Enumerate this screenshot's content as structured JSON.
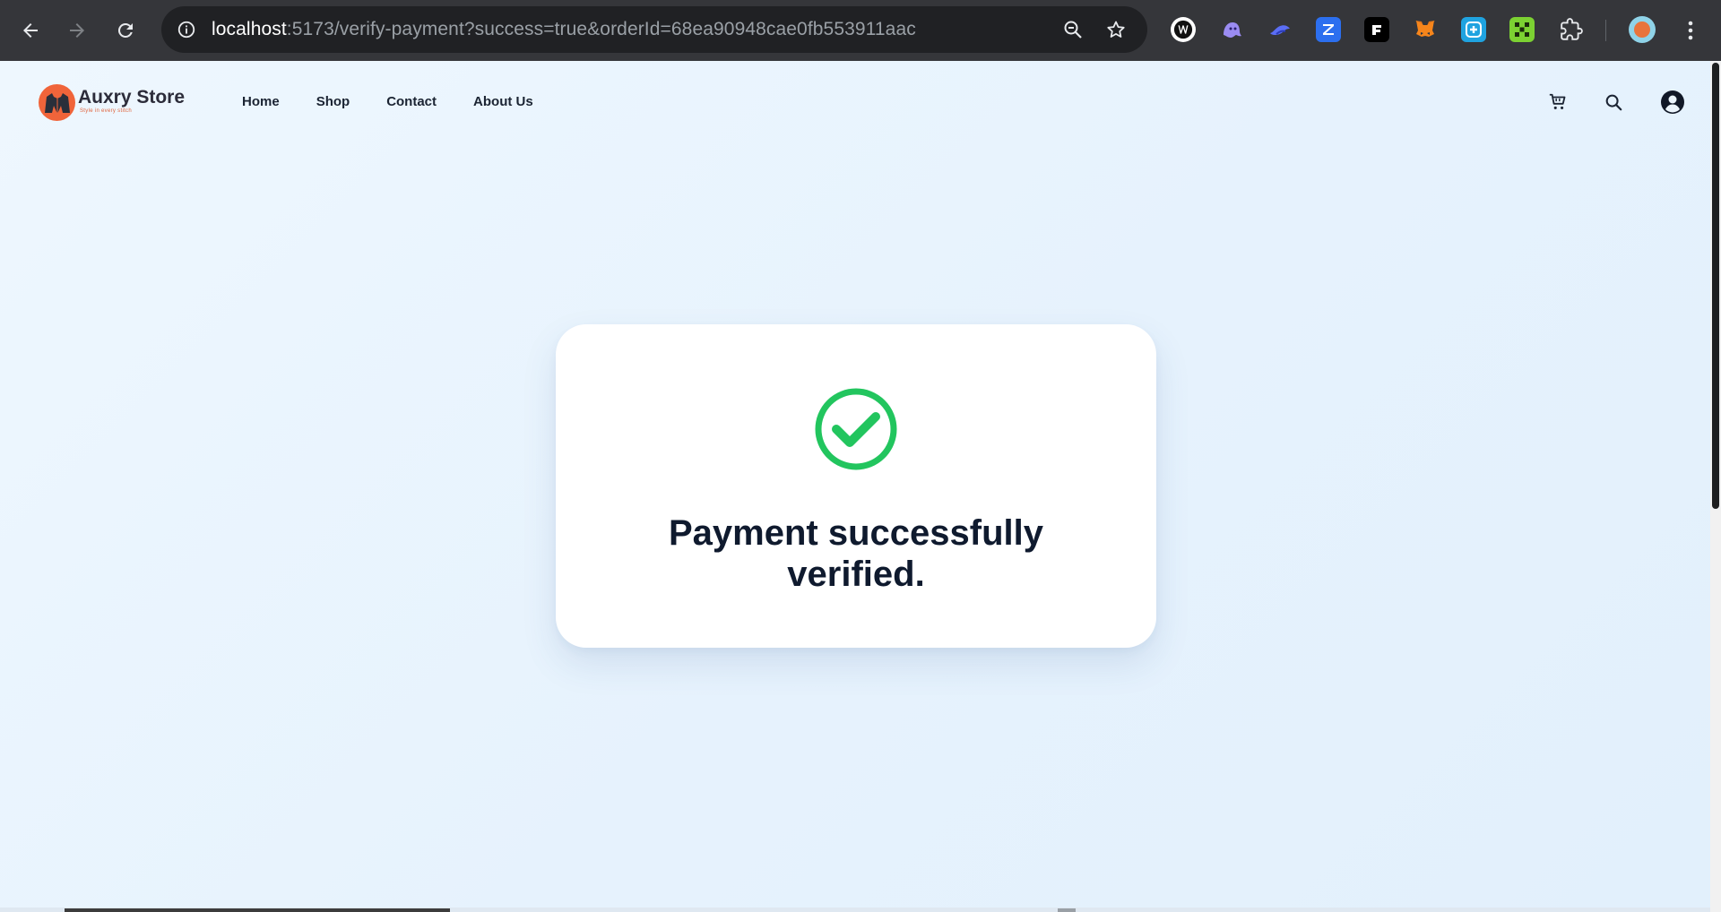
{
  "browser": {
    "url_host": "localhost",
    "url_rest": ":5173/verify-payment?success=true&orderId=68ea90948cae0fb553911aac",
    "extensions": [
      "wappalyzer-icon",
      "ghost-icon",
      "bird-icon",
      "zeplin-icon",
      "frame-icon",
      "metamask-icon",
      "plus-square-icon",
      "grid-icon"
    ]
  },
  "site": {
    "brand_name": "Auxry Store",
    "tagline": "Style in every stitch",
    "nav": {
      "home": "Home",
      "shop": "Shop",
      "contact": "Contact",
      "about": "About Us"
    }
  },
  "status": {
    "line1": "Payment successfully",
    "line2": "verified.",
    "color": "#22c55e"
  },
  "colors": {
    "brand_accent": "#f0643a",
    "text_dark": "#0f1a2e",
    "page_bg": "#ecf5fd"
  }
}
